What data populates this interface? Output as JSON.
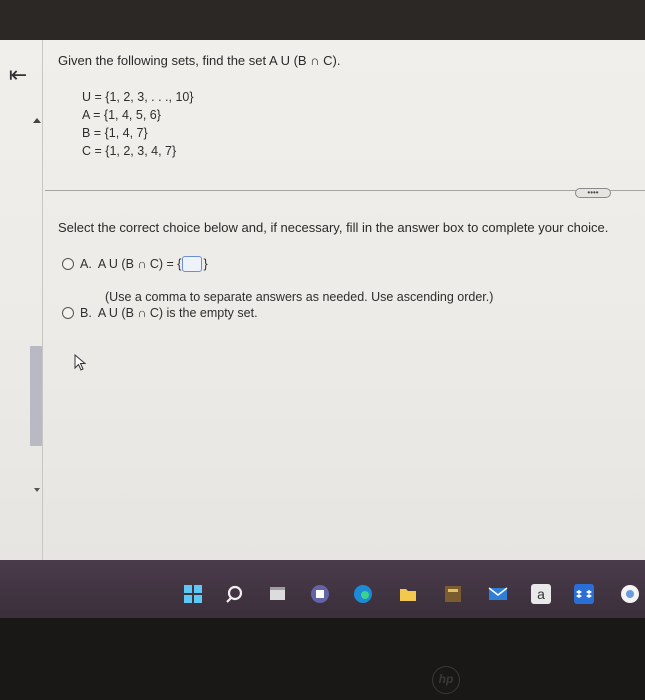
{
  "question": {
    "prompt": "Given the following sets, find the set A U (B ∩ C).",
    "sets": [
      "U = {1, 2, 3, . . ., 10}",
      "A = {1, 4, 5, 6}",
      "B = {1, 4, 7}",
      "C = {1, 2, 3, 4, 7}"
    ]
  },
  "more_button": "••••",
  "instruction": "Select the correct choice below and, if necessary, fill in the answer box to complete your choice.",
  "options": {
    "a": {
      "letter": "A.",
      "expression_prefix": "A U (B ∩ C) = {",
      "expression_suffix": "}",
      "hint": "(Use a comma to separate answers as needed. Use ascending order.)"
    },
    "b": {
      "letter": "B.",
      "text": "A U (B ∩ C) is the empty set."
    }
  },
  "brand_logo": "hp",
  "taskbar": {
    "icons": [
      "windows-start-icon",
      "search-icon",
      "file-explorer-icon",
      "teams-icon",
      "edge-icon",
      "folder-icon",
      "calculator-icon",
      "mail-icon",
      "app-a-icon",
      "dropbox-icon",
      "chrome-icon"
    ]
  }
}
